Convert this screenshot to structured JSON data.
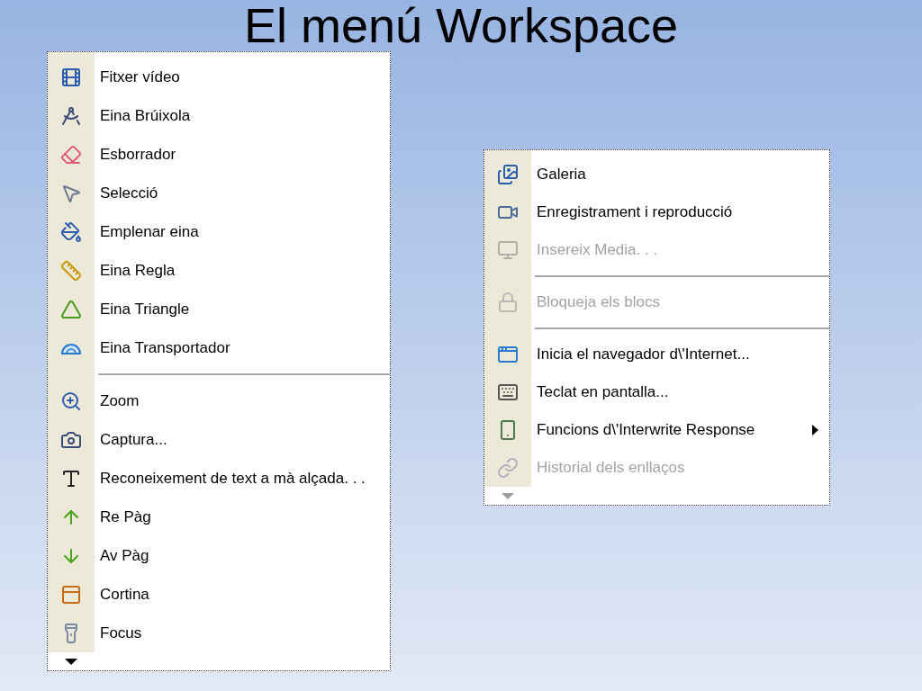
{
  "slide_title": "El menú Workspace",
  "menus": [
    {
      "scroll_down_enabled": true,
      "items": [
        {
          "kind": "item",
          "label": "Fitxer vídeo",
          "disabled": false,
          "has_submenu": false
        },
        {
          "kind": "item",
          "label": "Eina Brúixola",
          "disabled": false,
          "has_submenu": false
        },
        {
          "kind": "item",
          "label": "Esborrador",
          "disabled": false,
          "has_submenu": false
        },
        {
          "kind": "item",
          "label": "Selecció",
          "disabled": false,
          "has_submenu": false
        },
        {
          "kind": "item",
          "label": "Emplenar eina",
          "disabled": false,
          "has_submenu": false
        },
        {
          "kind": "item",
          "label": "Eina Regla",
          "disabled": false,
          "has_submenu": false
        },
        {
          "kind": "item",
          "label": "Eina Triangle",
          "disabled": false,
          "has_submenu": false
        },
        {
          "kind": "item",
          "label": "Eina Transportador",
          "disabled": false,
          "has_submenu": false
        },
        {
          "kind": "separator"
        },
        {
          "kind": "item",
          "label": "Zoom",
          "disabled": false,
          "has_submenu": false
        },
        {
          "kind": "item",
          "label": "Captura...",
          "disabled": false,
          "has_submenu": false
        },
        {
          "kind": "item",
          "label": "Reconeixement de text a mà alçada. . .",
          "disabled": false,
          "has_submenu": false
        },
        {
          "kind": "item",
          "label": "Re Pàg",
          "disabled": false,
          "has_submenu": false
        },
        {
          "kind": "item",
          "label": "Av Pàg",
          "disabled": false,
          "has_submenu": false
        },
        {
          "kind": "item",
          "label": "Cortina",
          "disabled": false,
          "has_submenu": false
        },
        {
          "kind": "item",
          "label": "Focus",
          "disabled": false,
          "has_submenu": false
        }
      ]
    },
    {
      "scroll_down_enabled": false,
      "items": [
        {
          "kind": "item",
          "label": "Galeria",
          "disabled": false,
          "has_submenu": false
        },
        {
          "kind": "item",
          "label": "Enregistrament i reproducció",
          "disabled": false,
          "has_submenu": false
        },
        {
          "kind": "item",
          "label": "Insereix Media. . .",
          "disabled": true,
          "has_submenu": false
        },
        {
          "kind": "separator"
        },
        {
          "kind": "item",
          "label": "Bloqueja els blocs",
          "disabled": true,
          "has_submenu": false
        },
        {
          "kind": "separator"
        },
        {
          "kind": "item",
          "label": "Inicia el navegador d\\'Internet...",
          "disabled": false,
          "has_submenu": false
        },
        {
          "kind": "item",
          "label": "Teclat en pantalla...",
          "disabled": false,
          "has_submenu": false
        },
        {
          "kind": "item",
          "label": "Funcions d\\'Interwrite Response",
          "disabled": false,
          "has_submenu": true
        },
        {
          "kind": "item",
          "label": "Historial dels enllaços",
          "disabled": true,
          "has_submenu": false
        }
      ]
    }
  ]
}
